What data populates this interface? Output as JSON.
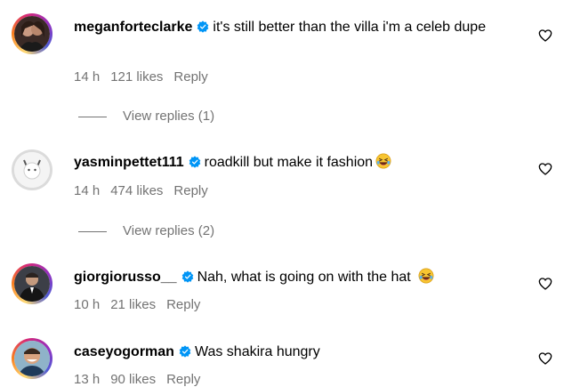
{
  "comments": [
    {
      "username": "meganforteclarke",
      "text": "it's still better than the villa i'm a celeb dupe",
      "time": "14 h",
      "likes": "121 likes",
      "reply": "Reply",
      "view_replies": "View replies (1)"
    },
    {
      "username": "yasminpettet111",
      "text": "roadkill but make it fashion",
      "time": "14 h",
      "likes": "474 likes",
      "reply": "Reply",
      "view_replies": "View replies (2)"
    },
    {
      "username": "giorgiorusso__",
      "text": "Nah, what is going on with the hat",
      "time": "10 h",
      "likes": "21 likes",
      "reply": "Reply"
    },
    {
      "username": "caseyogorman",
      "text": "Was shakira hungry",
      "time": "13 h",
      "likes": "90 likes",
      "reply": "Reply"
    }
  ],
  "colors": {
    "verified": "#0095f6",
    "meta": "#737373",
    "text": "#000000"
  },
  "icons": {
    "like": "heart-outline-icon",
    "verified": "verified-badge-icon",
    "emoji": "laughing-face-emoji"
  }
}
